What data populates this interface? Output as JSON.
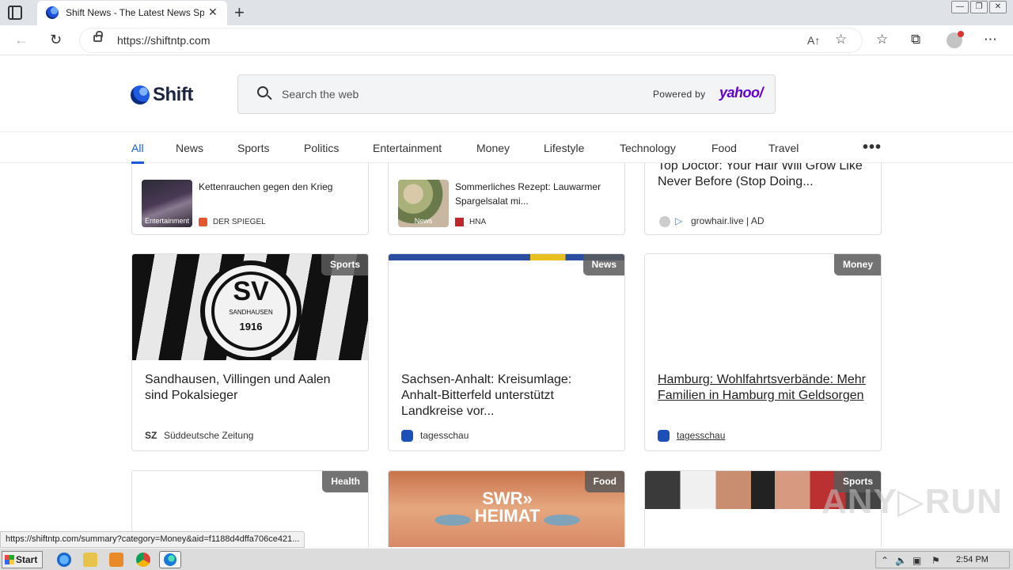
{
  "browser": {
    "tab_title": "Shift News - The Latest News Spc",
    "url": "https://shiftntp.com",
    "read_aloud_label": "A↑",
    "status_url": "https://shiftntp.com/summary?category=Money&aid=f1188d4dffa706ce421..."
  },
  "header": {
    "logo_text": "Shift",
    "search_placeholder": "Search the web",
    "powered_by": "Powered by",
    "yahoo": "yahoo/"
  },
  "categories": [
    "All",
    "News",
    "Sports",
    "Politics",
    "Entertainment",
    "Money",
    "Lifestyle",
    "Technology",
    "Food",
    "Travel"
  ],
  "top_cards": [
    {
      "title": "Kettenrauchen gegen den Krieg",
      "tag": "Entertainment",
      "source": "DER SPIEGEL"
    },
    {
      "title": "Sommerliches Rezept: Lauwarmer Spargelsalat mi...",
      "tag": "News",
      "source": "HNA"
    },
    {
      "title": "Top Doctor: Your Hair Will Grow Like Never Before (Stop Doing...",
      "source": "growhair.live | AD"
    }
  ],
  "cards": [
    {
      "badge": "Sports",
      "title": "Sandhausen, Villingen und Aalen sind Pokalsieger",
      "source": "Süddeutsche Zeitung",
      "image_text": "SV",
      "image_subtext": "SANDHAUSEN",
      "image_year": "1916"
    },
    {
      "badge": "News",
      "title": "Sachsen-Anhalt: Kreisumlage: Anhalt-Bitterfeld unterstützt Landkreise vor...",
      "source": "tagesschau"
    },
    {
      "badge": "Money",
      "title": "Hamburg: Wohlfahrtsverbände: Mehr Familien in Hamburg mit Geldsorgen",
      "source": "tagesschau"
    }
  ],
  "bottom_cards": [
    {
      "badge": "Health"
    },
    {
      "badge": "Food",
      "image_text": "SWR» HEIMAT"
    },
    {
      "badge": "Sports"
    }
  ],
  "watermark": "ANY▷RUN",
  "taskbar": {
    "start_label": "Start",
    "clock": "2:54 PM"
  },
  "colors": {
    "accent": "#1a5ad7",
    "yahoo": "#6001d2",
    "badge_bg": "#5a5a5a"
  }
}
